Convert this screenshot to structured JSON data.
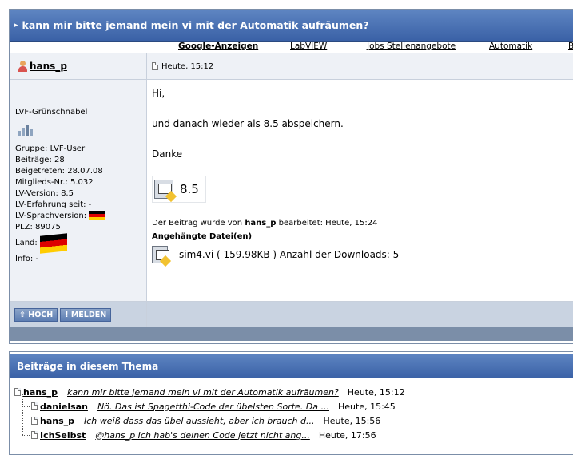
{
  "thread": {
    "title": "kann mir bitte jemand mein vi mit der Automatik aufräumen?"
  },
  "ads": {
    "google": "Google-Anzeigen",
    "links": [
      "LabVIEW",
      "Jobs Stellenangebote",
      "Automatik",
      "B"
    ]
  },
  "post": {
    "author": "hans_p",
    "timestamp": "Heute, 15:12",
    "rank": "LVF-Grünschnabel",
    "profile": {
      "gruppe": "Gruppe: LVF-User",
      "beitraege": "Beiträge: 28",
      "beigetreten": "Beigetreten: 28.07.08",
      "mitglieds_nr": "Mitglieds-Nr.: 5.032",
      "lv_version": "LV-Version: 8.5",
      "lv_erfahrung": "LV-Erfahrung seit: -",
      "lv_sprachversion": "LV-Sprachversion:",
      "plz": "PLZ: 89075",
      "land": "Land:",
      "info": "Info: -"
    },
    "body": {
      "line1": "Hi,",
      "line2": "und danach wieder als 8.5 abspeichern.",
      "line3": "Danke",
      "vi_version": "8.5"
    },
    "edited": {
      "prefix": "Der Beitrag wurde von",
      "user": "hans_p",
      "suffix": "bearbeitet: Heute, 15:24"
    },
    "attachments": {
      "heading": "Angehängte Datei(en)",
      "file": "sim4.vi",
      "size": "( 159.98KB )",
      "downloads": "Anzahl der Downloads: 5"
    },
    "buttons": {
      "top": "⇧ HOCH",
      "report": "! MELDEN"
    }
  },
  "thread_list": {
    "heading": "Beiträge in diesem Thema",
    "items": [
      {
        "author": "hans_p",
        "subject": "kann mir bitte jemand mein vi mit der Automatik aufräumen?",
        "time": "Heute, 15:12"
      },
      {
        "author": "danielsan",
        "subject": "Nö. Das ist Spagetthi-Code der übelsten Sorte. Da ...",
        "time": "Heute, 15:45"
      },
      {
        "author": "hans_p",
        "subject": "Ich weiß dass das übel aussieht, aber ich brauch d...",
        "time": "Heute, 15:56"
      },
      {
        "author": "IchSelbst",
        "subject": "@hans_p Ich hab's deinen Code jetzt nicht ang...",
        "time": "Heute, 17:56"
      }
    ]
  },
  "colors": {
    "header_blue": "#3a61a6",
    "panel": "#eef1f6",
    "footer": "#c9d3e1"
  }
}
